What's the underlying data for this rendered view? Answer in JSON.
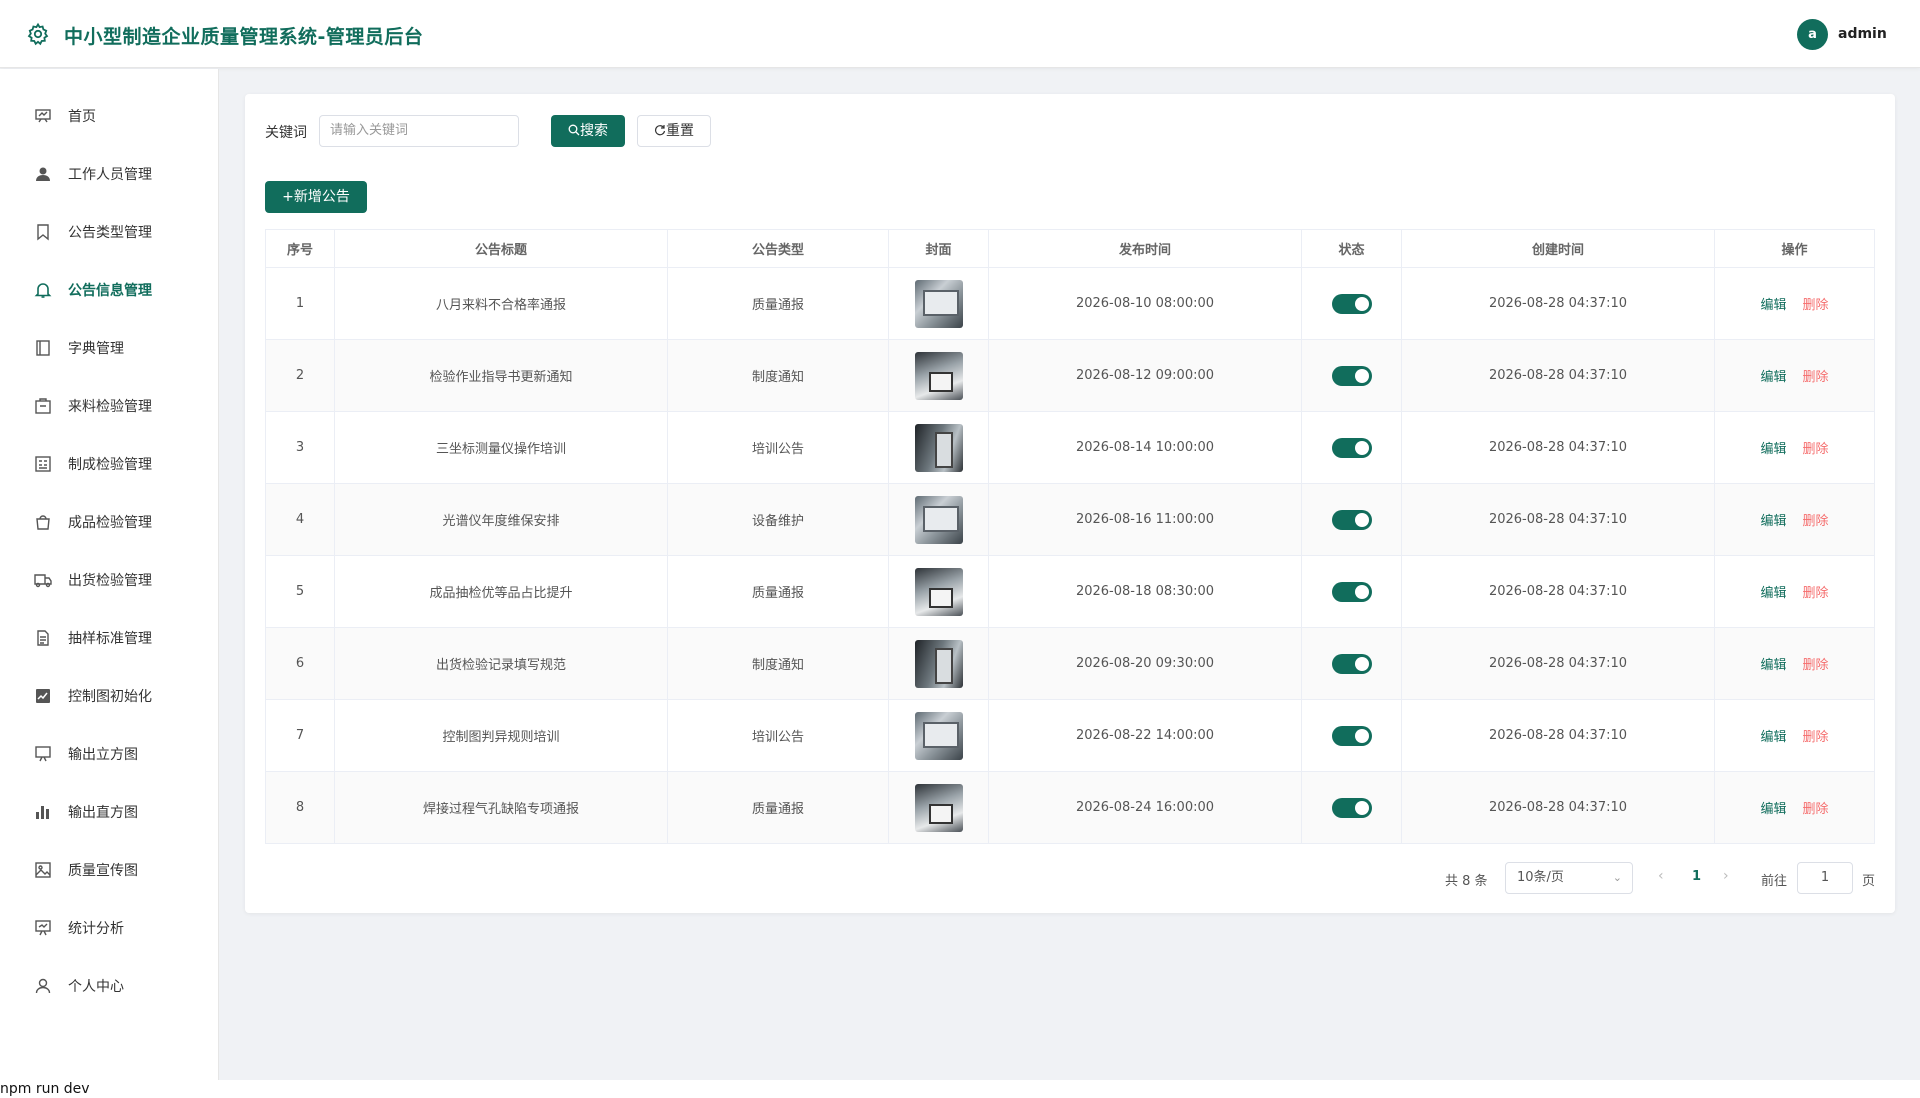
{
  "header": {
    "title": "中小型制造企业质量管理系统-管理员后台",
    "avatar_letter": "a",
    "username": "admin"
  },
  "sidebar": {
    "items": [
      {
        "label": "首页",
        "icon": "presentation-icon"
      },
      {
        "label": "工作人员管理",
        "icon": "user-icon"
      },
      {
        "label": "公告类型管理",
        "icon": "bookmark-icon"
      },
      {
        "label": "公告信息管理",
        "icon": "bell-icon",
        "active": true
      },
      {
        "label": "字典管理",
        "icon": "book-icon"
      },
      {
        "label": "来料检验管理",
        "icon": "box-icon"
      },
      {
        "label": "制成检验管理",
        "icon": "checklist-icon"
      },
      {
        "label": "成品检验管理",
        "icon": "bag-icon"
      },
      {
        "label": "出货检验管理",
        "icon": "truck-icon"
      },
      {
        "label": "抽样标准管理",
        "icon": "document-icon"
      },
      {
        "label": "控制图初始化",
        "icon": "line-chart-icon"
      },
      {
        "label": "输出立方图",
        "icon": "cube-chart-icon"
      },
      {
        "label": "输出直方图",
        "icon": "bar-chart-icon"
      },
      {
        "label": "质量宣传图",
        "icon": "picture-icon"
      },
      {
        "label": "统计分析",
        "icon": "statistics-icon"
      },
      {
        "label": "个人中心",
        "icon": "person-icon"
      }
    ]
  },
  "search": {
    "label": "关键词",
    "placeholder": "请输入关键词",
    "search_button": "搜索",
    "reset_button": "重置",
    "add_button": "新增公告"
  },
  "table": {
    "columns": [
      "序号",
      "公告标题",
      "公告类型",
      "封面",
      "发布时间",
      "状态",
      "创建时间",
      "操作"
    ],
    "rows": [
      {
        "no": "1",
        "title": "八月来料不合格率通报",
        "type": "质量通报",
        "publish": "2026-08-10 08:00:00",
        "created": "2026-08-28 04:37:10"
      },
      {
        "no": "2",
        "title": "检验作业指导书更新通知",
        "type": "制度通知",
        "publish": "2026-08-12 09:00:00",
        "created": "2026-08-28 04:37:10"
      },
      {
        "no": "3",
        "title": "三坐标测量仪操作培训",
        "type": "培训公告",
        "publish": "2026-08-14 10:00:00",
        "created": "2026-08-28 04:37:10"
      },
      {
        "no": "4",
        "title": "光谱仪年度维保安排",
        "type": "设备维护",
        "publish": "2026-08-16 11:00:00",
        "created": "2026-08-28 04:37:10"
      },
      {
        "no": "5",
        "title": "成品抽检优等品占比提升",
        "type": "质量通报",
        "publish": "2026-08-18 08:30:00",
        "created": "2026-08-28 04:37:10"
      },
      {
        "no": "6",
        "title": "出货检验记录填写规范",
        "type": "制度通知",
        "publish": "2026-08-20 09:30:00",
        "created": "2026-08-28 04:37:10"
      },
      {
        "no": "7",
        "title": "控制图判异规则培训",
        "type": "培训公告",
        "publish": "2026-08-22 14:00:00",
        "created": "2026-08-28 04:37:10"
      },
      {
        "no": "8",
        "title": "焊接过程气孔缺陷专项通报",
        "type": "质量通报",
        "publish": "2026-08-24 16:00:00",
        "created": "2026-08-28 04:37:10"
      }
    ],
    "edit_label": "编辑",
    "delete_label": "删除"
  },
  "pagination": {
    "total": "共 8 条",
    "page_size": "10条/页",
    "current": "1",
    "goto_label": "前往",
    "goto_value": "1",
    "goto_suffix": "页"
  },
  "terminal": {
    "text": "npm run dev"
  },
  "colors": {
    "accent": "#116d5c",
    "danger": "#f56c6c"
  }
}
